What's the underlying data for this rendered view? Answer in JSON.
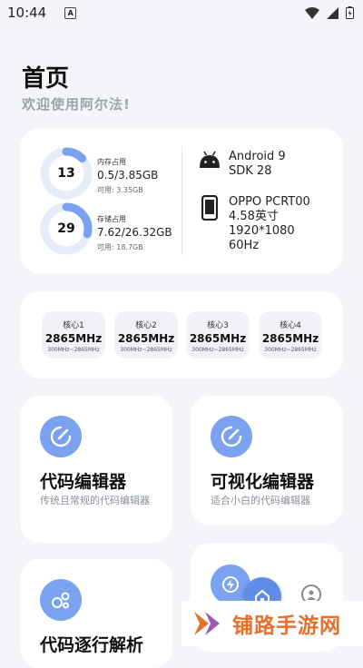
{
  "status_bar": {
    "time": "10:44",
    "notification_icon": "a-box-icon",
    "icons": [
      "wifi-icon",
      "signal-icon",
      "battery-icon"
    ]
  },
  "header": {
    "title": "首页",
    "subtitle": "欢迎使用阿尔法!"
  },
  "system": {
    "memory": {
      "percent": "13",
      "fill_fraction": 0.13,
      "label": "内存占用",
      "value": "0.5/3.85GB",
      "available": "可用: 3.35GB"
    },
    "storage": {
      "percent": "29",
      "fill_fraction": 0.29,
      "label": "存储占用",
      "value": "7.62/26.32GB",
      "available": "可用: 18.7GB"
    },
    "android": {
      "icon": "android-icon",
      "line1": "Android 9",
      "line2": "SDK 28"
    },
    "device": {
      "icon": "phone-icon",
      "line1": "OPPO PCRT00",
      "line2": "4.58英寸",
      "line3": "1920*1080",
      "line4": "60Hz"
    }
  },
  "cpu": {
    "cores": [
      {
        "name": "核心1",
        "freq": "2865MHz",
        "range": "300MHz~2865MHz"
      },
      {
        "name": "核心2",
        "freq": "2865MHz",
        "range": "300MHz~2865MHz"
      },
      {
        "name": "核心3",
        "freq": "2865MHz",
        "range": "300MHz~2865MHz"
      },
      {
        "name": "核心4",
        "freq": "2865MHz",
        "range": "300MHz~2865MHz"
      }
    ]
  },
  "features": [
    {
      "icon": "edit-icon",
      "title": "代码编辑器",
      "desc": "传统且常规的代码编辑器"
    },
    {
      "icon": "edit-icon",
      "title": "可视化编辑器",
      "desc": "适合小白的代码编辑器"
    },
    {
      "icon": "bubbles-icon",
      "title": "代码逐行解析",
      "desc": ""
    }
  ],
  "overlay": {
    "fab_icons": [
      "lightning-icon",
      "home-icon",
      "profile-icon"
    ]
  },
  "watermark": {
    "text": "铺路手游网"
  },
  "colors": {
    "accent": "#7aa2f0",
    "ring_track": "#e6ecfa",
    "background": "#f4f5f9",
    "watermark": "#e8702b"
  }
}
